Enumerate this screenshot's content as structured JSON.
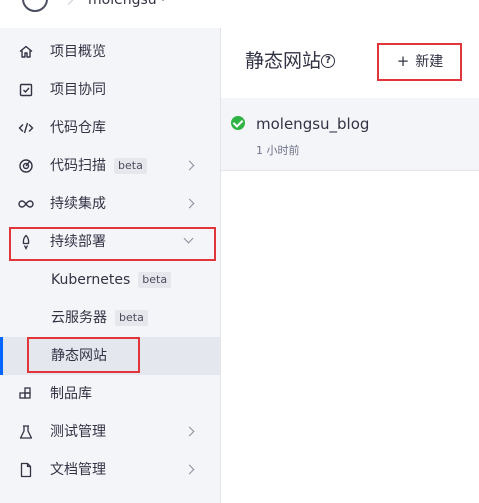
{
  "header": {
    "project_name": "molengsu"
  },
  "sidebar": {
    "items": [
      {
        "label": "项目概览",
        "icon": "home-icon"
      },
      {
        "label": "项目协同",
        "icon": "checkbox-icon"
      },
      {
        "label": "代码仓库",
        "icon": "code-icon"
      },
      {
        "label": "代码扫描",
        "badge": "beta",
        "icon": "scan-icon"
      },
      {
        "label": "持续集成",
        "icon": "infinity-icon"
      },
      {
        "label": "持续部署",
        "icon": "rocket-icon"
      },
      {
        "label": "制品库",
        "icon": "package-icon"
      },
      {
        "label": "测试管理",
        "icon": "flask-icon"
      },
      {
        "label": "文档管理",
        "icon": "document-icon"
      }
    ],
    "deploy_sub": [
      {
        "label": "Kubernetes",
        "badge": "beta"
      },
      {
        "label": "云服务器",
        "badge": "beta"
      },
      {
        "label": "静态网站",
        "active": true
      }
    ]
  },
  "main": {
    "title": "静态网站",
    "new_button": "新建",
    "sites": [
      {
        "name": "molengsu_blog",
        "time": "1 小时前",
        "status": "success"
      }
    ]
  },
  "colors": {
    "accent": "#0066ff",
    "highlight": "#e0353b",
    "success": "#2fb344"
  }
}
